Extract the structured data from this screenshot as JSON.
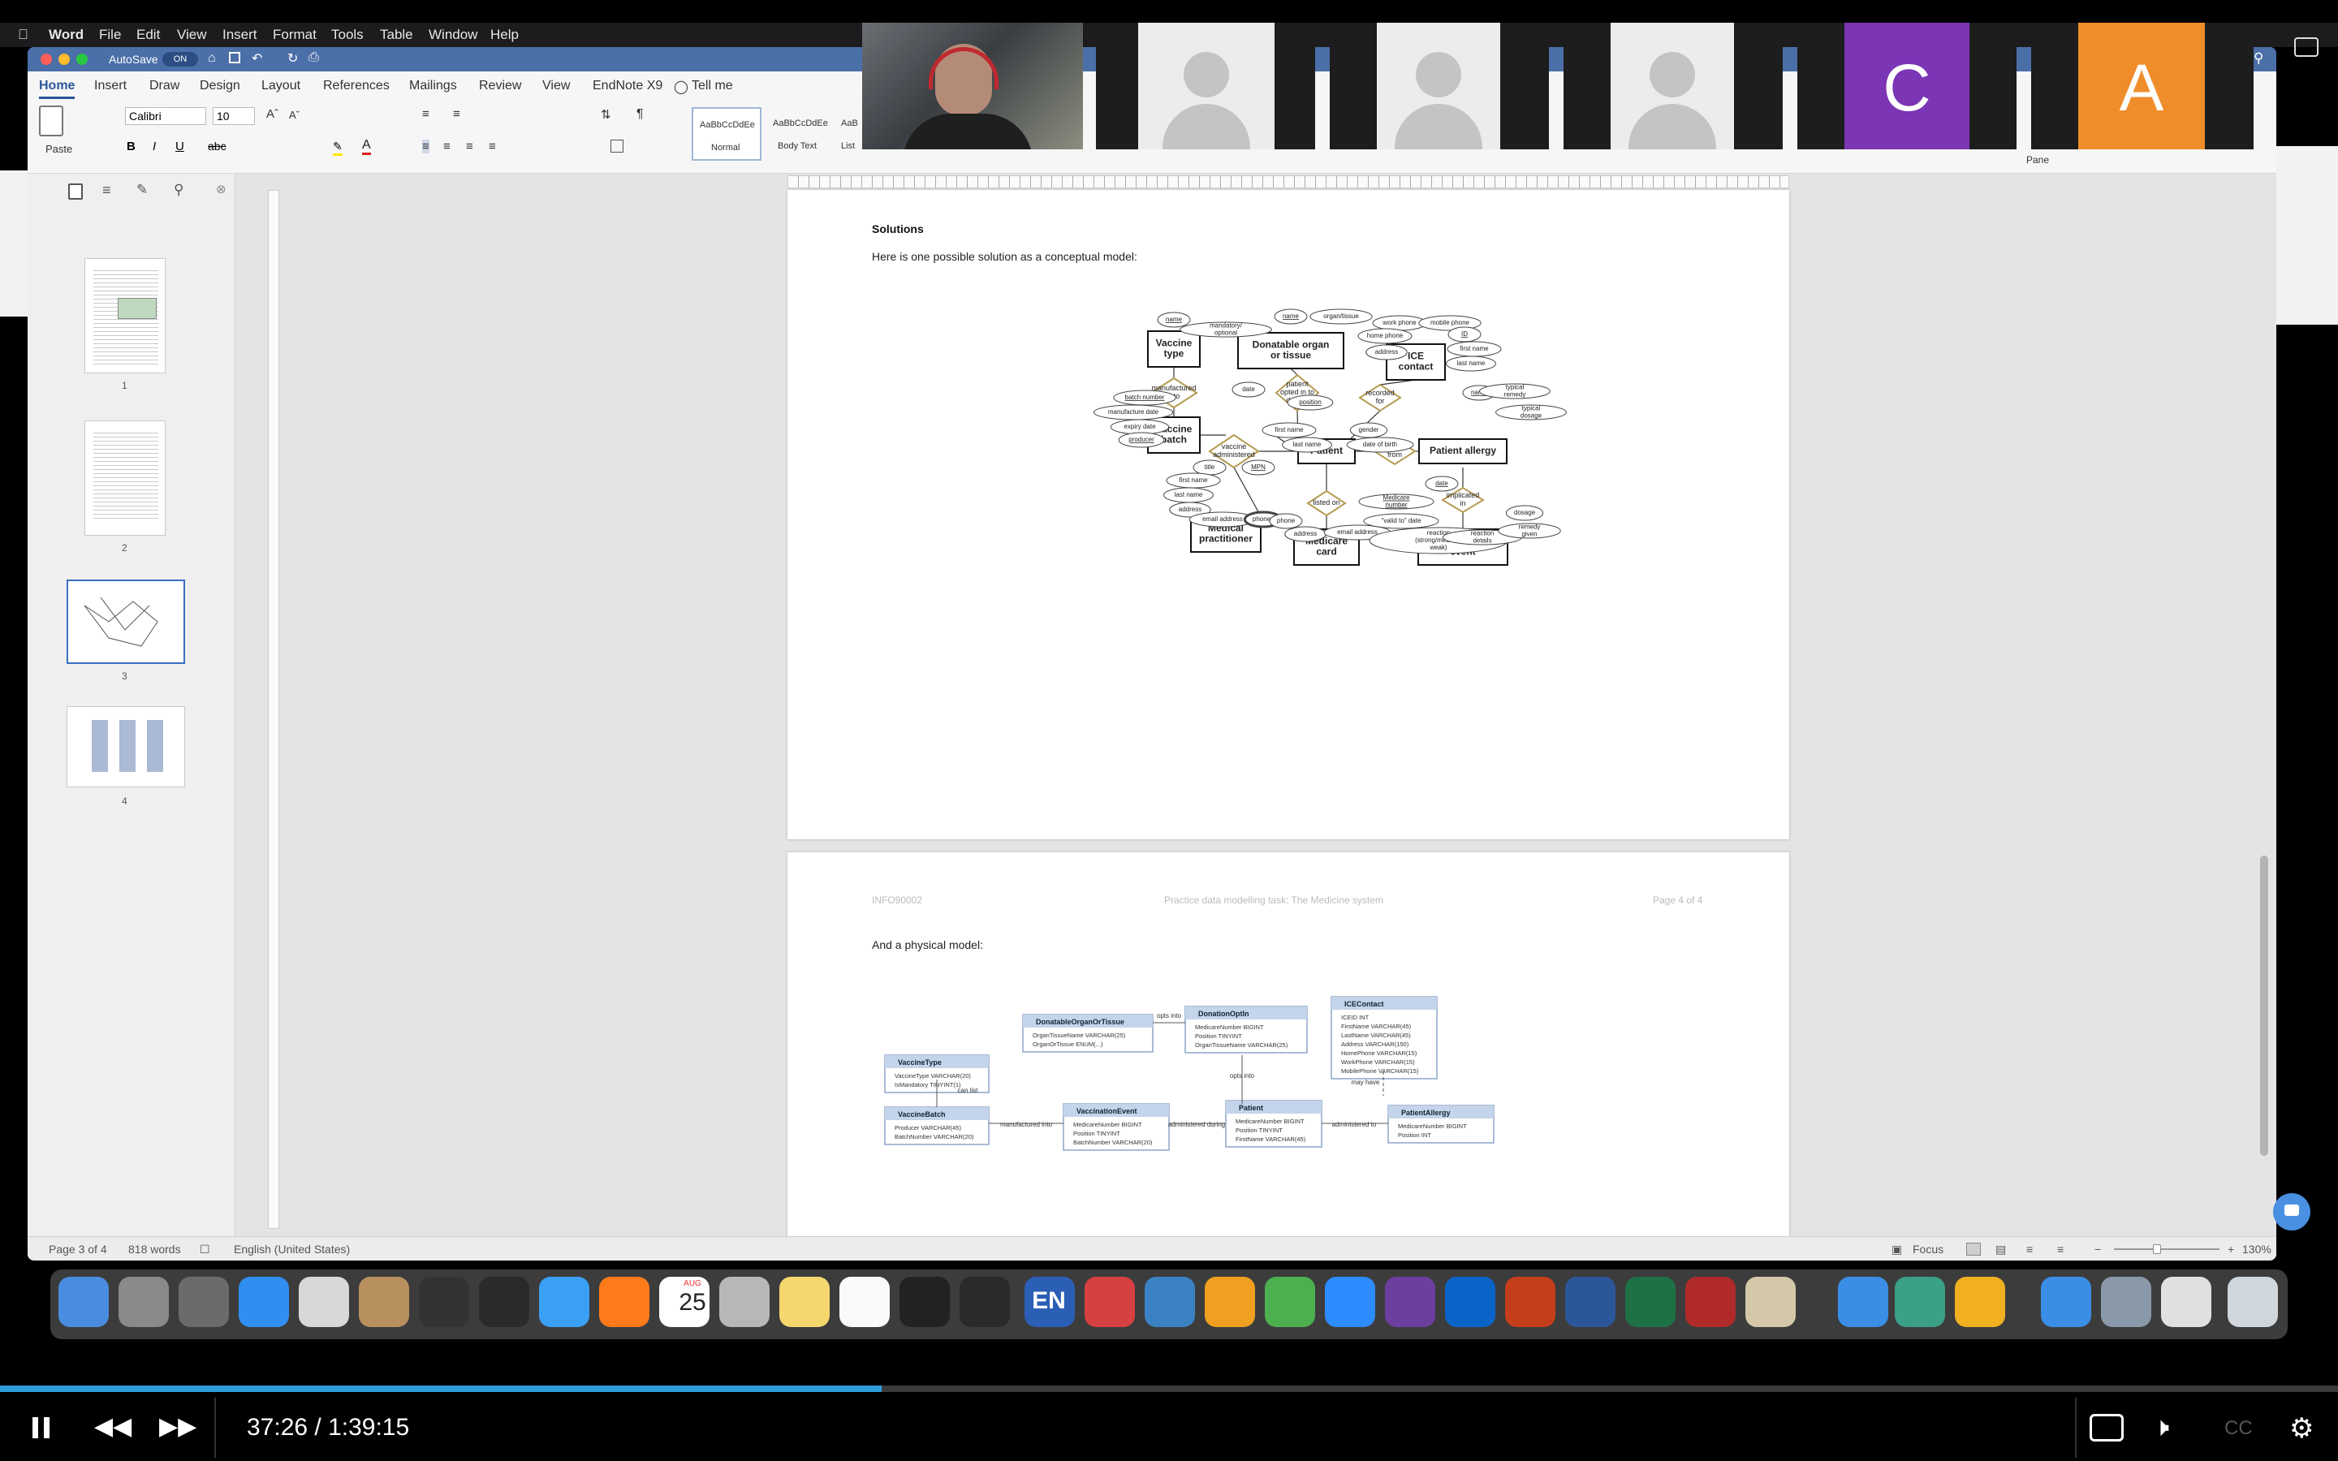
{
  "menubar": {
    "app": "Word",
    "items": [
      "File",
      "Edit",
      "View",
      "Insert",
      "Format",
      "Tools",
      "Table",
      "Window",
      "Help"
    ]
  },
  "titlebar": {
    "autosave": "AutoSave",
    "autosave_state": "ON"
  },
  "ribbon": {
    "tabs": [
      "Home",
      "Insert",
      "Draw",
      "Design",
      "Layout",
      "References",
      "Mailings",
      "Review",
      "View",
      "EndNote X9"
    ],
    "tell_me": "Tell me",
    "font": "Calibri",
    "font_size": "10",
    "paste": "Paste",
    "styles": [
      {
        "preview": "AaBbCcDdEe",
        "name": "Normal"
      },
      {
        "preview": "AaBbCcDdEe",
        "name": "Body Text"
      },
      {
        "preview": "AaB",
        "name": "List"
      }
    ],
    "pane": "Pane"
  },
  "nav": {
    "pages": [
      "1",
      "2",
      "3",
      "4"
    ]
  },
  "doc": {
    "solutions_heading": "Solutions",
    "solutions_intro": "Here is one possible solution as a conceptual model:",
    "header_left": "INFO90002",
    "header_center": "Practice data modelling task: The Medicine system",
    "header_right": "Page 4 of 4",
    "physical_intro": "And a physical model:"
  },
  "er": {
    "entities": [
      "Vaccine type",
      "Donatable organ or tissue",
      "ICE contact",
      "Vaccine batch",
      "Patient",
      "Patient allergy",
      "Medical practitioner",
      "Medicare card",
      "Patient allergy event"
    ],
    "relationships": [
      "manufactured into",
      "patient opted in to donate",
      "recorded for",
      "vaccine administered",
      "suffers from",
      "listed on",
      "implicated in"
    ],
    "attributes": [
      "name",
      "mandatory/ optional",
      "name",
      "organ/tissue",
      "work phone",
      "mobile phone",
      "ID",
      "home phone",
      "first name",
      "address",
      "last name",
      "date",
      "batch number",
      "manufacture date",
      "expiry date",
      "producer",
      "position",
      "first name",
      "last name",
      "gender",
      "date of birth",
      "name",
      "typical remedy",
      "typical dosage",
      "title",
      "MPN",
      "first name",
      "last name",
      "address",
      "email address",
      "phones",
      "Medicare number",
      "phone",
      "address",
      "email address",
      "\"valid to\" date",
      "date",
      "dosage",
      "reaction (strong/medium/ weak)",
      "reaction details",
      "remedy given"
    ]
  },
  "physical": {
    "tables": [
      {
        "name": "DonatableOrganOrTissue",
        "cols": [
          "OrganTissueName VARCHAR(25)",
          "OrganOrTissue ENUM(...)"
        ]
      },
      {
        "name": "DonationOptIn",
        "cols": [
          "MedicareNumber BIGINT",
          "Position TINYINT",
          "OrganTissueName VARCHAR(25)"
        ]
      },
      {
        "name": "ICEContact",
        "cols": [
          "ICEID INT",
          "FirstName VARCHAR(45)",
          "LastName VARCHAR(45)",
          "Address VARCHAR(150)",
          "HomePhone VARCHAR(15)",
          "WorkPhone VARCHAR(15)",
          "MobilePhone VARCHAR(15)"
        ]
      },
      {
        "name": "VaccineType",
        "cols": [
          "VaccineType VARCHAR(20)",
          "IsMandatory TINYINT(1)"
        ]
      },
      {
        "name": "VaccineBatch",
        "cols": [
          "Producer VARCHAR(45)",
          "BatchNumber VARCHAR(20)"
        ]
      },
      {
        "name": "VaccinationEvent",
        "cols": [
          "MedicareNumber BIGINT",
          "Position TINYINT",
          "BatchNumber VARCHAR(20)"
        ]
      },
      {
        "name": "Patient",
        "cols": [
          "MedicareNumber BIGINT",
          "Position TINYINT",
          "FirstName VARCHAR(45)"
        ]
      },
      {
        "name": "PatientAllergy",
        "cols": [
          "MedicareNumber BIGINT",
          "Position INT"
        ]
      }
    ],
    "rels": [
      "opts into",
      "opts into",
      "can list",
      "manufactured into",
      "administered during",
      "administered to",
      "may have"
    ]
  },
  "statusbar": {
    "page": "Page 3 of 4",
    "words": "818 words",
    "language": "English (United States)",
    "focus": "Focus",
    "zoom": "130%"
  },
  "video": {
    "initials": [
      "C",
      "A"
    ],
    "colors": {
      "c": "#7b35b5",
      "a": "#f08d2b"
    }
  },
  "dock": {
    "calendar_month": "AUG",
    "calendar_day": "25",
    "en": "EN"
  },
  "player": {
    "time": "37:26 / 1:39:15",
    "progress": 0.377,
    "cc": "CC"
  }
}
